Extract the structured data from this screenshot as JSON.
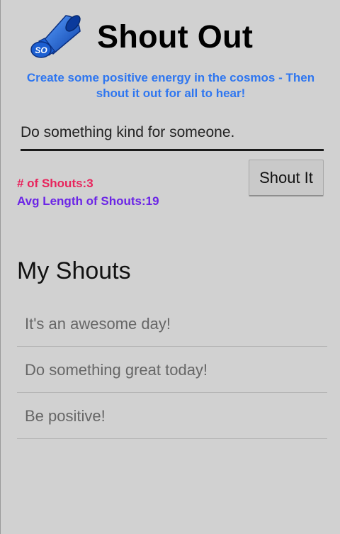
{
  "app": {
    "title": "Shout Out",
    "logo_icon": "megaphone-icon",
    "logo_text": "SO",
    "tagline": "Create some positive energy in the cosmos - Then shout it out for all to hear!"
  },
  "composer": {
    "input_value": "Do something kind for someone.",
    "button_label": "Shout It"
  },
  "stats": {
    "count_text": "# of Shouts:3",
    "avg_text": "Avg Length of Shouts:19"
  },
  "list": {
    "title": "My Shouts",
    "items": [
      {
        "text": "It's an awesome day!"
      },
      {
        "text": "Do something great today!"
      },
      {
        "text": "Be positive!"
      }
    ]
  },
  "colors": {
    "background": "#d1d1d1",
    "tagline": "#2e76f0",
    "count": "#e8245c",
    "avg": "#6b25e6",
    "logo_blue": "#1c5fd1"
  }
}
